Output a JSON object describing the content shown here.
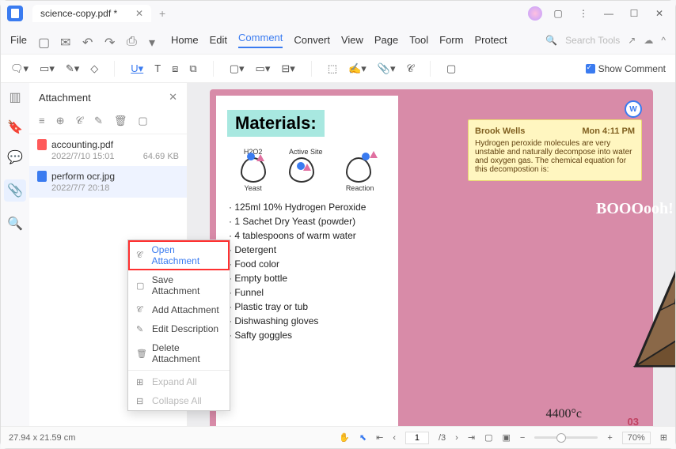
{
  "titlebar": {
    "filename": "science-copy.pdf *"
  },
  "menubar": {
    "file": "File",
    "items": [
      "Home",
      "Edit",
      "Comment",
      "Convert",
      "View",
      "Page",
      "Tool",
      "Form",
      "Protect"
    ],
    "active_index": 2,
    "search_placeholder": "Search Tools"
  },
  "toolbar": {
    "show_comment": "Show Comment"
  },
  "panel": {
    "title": "Attachment",
    "files": [
      {
        "name": "accounting.pdf",
        "date": "2022/7/10 15:01",
        "size": "64.69 KB",
        "type": "pdf"
      },
      {
        "name": "perform ocr.jpg",
        "date": "2022/7/7 20:18",
        "size": "",
        "type": "img"
      }
    ]
  },
  "context_menu": {
    "items": [
      {
        "label": "Open Attachment",
        "highlight": true
      },
      {
        "label": "Save Attachment"
      },
      {
        "label": "Add Attachment"
      },
      {
        "label": "Edit Description"
      },
      {
        "label": "Delete Attachment"
      },
      {
        "label": "Expand All",
        "disabled": true
      },
      {
        "label": "Collapse All",
        "disabled": true
      }
    ]
  },
  "document": {
    "heading": "Materials:",
    "diagram_labels": {
      "h2o2": "H2O2",
      "active": "Active Site",
      "yeast": "Yeast",
      "reaction": "Reaction"
    },
    "list": [
      "125ml 10% Hydrogen Peroxide",
      "1 Sachet Dry Yeast (powder)",
      "4 tablespoons of warm water",
      "Detergent",
      "Food color",
      "Empty bottle",
      "Funnel",
      "Plastic tray or tub",
      "Dishwashing gloves",
      "Safty goggles"
    ],
    "note": {
      "author": "Brook Wells",
      "time": "Mon 4:11 PM",
      "body": "Hydrogen peroxide molecules are very unstable and naturally decompose into water and oxygen gas. The chemical equation for this decompostion is:"
    },
    "boo": "BOOOooh!",
    "temp": "4400°c",
    "pagenum": "03"
  },
  "statusbar": {
    "dimensions": "27.94 x 21.59 cm",
    "page_current": "1",
    "page_total": "/3",
    "zoom": "70%"
  }
}
